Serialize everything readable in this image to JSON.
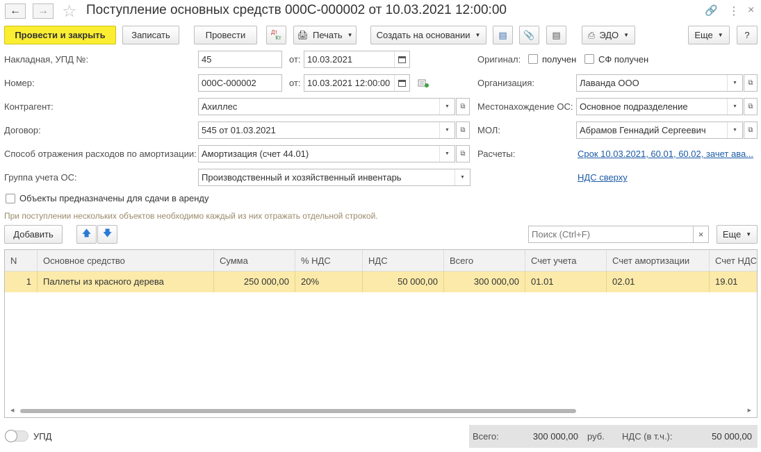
{
  "window": {
    "title": "Поступление основных средств 000С-000002 от 10.03.2021 12:00:00"
  },
  "toolbar": {
    "post_close": "Провести и закрыть",
    "save": "Записать",
    "post": "Провести",
    "dtkt_top": "Дт",
    "dtkt_bottom": "Кт",
    "print": "Печать",
    "create_based": "Создать на основании",
    "edo": "ЭДО",
    "more": "Еще",
    "help": "?"
  },
  "form": {
    "invoice_label": "Накладная, УПД №:",
    "invoice_value": "45",
    "from_label": "от:",
    "invoice_date": "10.03.2021",
    "number_label": "Номер:",
    "number_value": "000С-000002",
    "number_from_label": "от:",
    "number_date": "10.03.2021 12:00:00",
    "counterparty_label": "Контрагент:",
    "counterparty_value": "Ахиллес",
    "contract_label": "Договор:",
    "contract_value": "545 от 01.03.2021",
    "depr_method_label": "Способ отражения расходов по амортизации:",
    "depr_method_value": "Амортизация (счет 44.01)",
    "group_label": "Группа учета ОС:",
    "group_value": "Производственный и хозяйственный инвентарь",
    "original_label": "Оригинал:",
    "original_received": "получен",
    "sf_received": "СФ получен",
    "organization_label": "Организация:",
    "organization_value": "Лаванда ООО",
    "location_label": "Местонахождение ОС:",
    "location_value": "Основное подразделение",
    "mol_label": "МОЛ:",
    "mol_value": "Абрамов Геннадий Сергеевич",
    "settlements_label": "Расчеты:",
    "settlements_link": "Срок 10.03.2021, 60.01, 60.02, зачет ава...",
    "vat_link": "НДС сверху",
    "rent_checkbox": "Объекты предназначены для сдачи в аренду",
    "hint": "При поступлении нескольких объектов необходимо каждый из них отражать отдельной строкой."
  },
  "table_toolbar": {
    "add": "Добавить",
    "search_placeholder": "Поиск (Ctrl+F)",
    "clear": "×",
    "more": "Еще"
  },
  "table": {
    "headers": [
      "N",
      "Основное средство",
      "Сумма",
      "% НДС",
      "НДС",
      "Всего",
      "Счет учета",
      "Счет амортизации",
      "Счет НДС"
    ],
    "rows": [
      [
        "1",
        "Паллеты из красного дерева",
        "250 000,00",
        "20%",
        "50 000,00",
        "300 000,00",
        "01.01",
        "02.01",
        "19.01"
      ]
    ]
  },
  "footer": {
    "toggle_label": "УПД",
    "total_label": "Всего:",
    "total_value": "300 000,00",
    "currency": "руб.",
    "vat_label": "НДС (в т.ч.):",
    "vat_value": "50 000,00"
  },
  "colors": {
    "primary_button": "#fbed32",
    "selected_row": "#fbeaa9",
    "link": "#1c5ba8"
  }
}
